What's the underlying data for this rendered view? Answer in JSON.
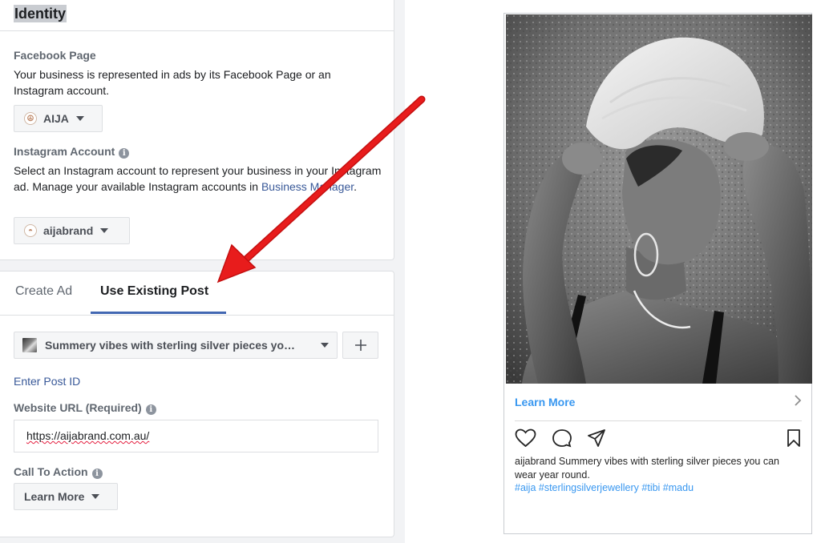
{
  "identity": {
    "title": "Identity",
    "facebook_page": {
      "label": "Facebook Page",
      "description": "Your business is represented in ads by its Facebook Page or an Instagram account.",
      "selected": "AIJA"
    },
    "instagram_account": {
      "label": "Instagram Account",
      "description_prefix": "Select an Instagram account to represent your business in your Instagram ad. Manage your available Instagram accounts in ",
      "link_text": "Business Manager",
      "description_suffix": ".",
      "selected": "aijabrand"
    }
  },
  "tabs": [
    {
      "label": "Create Ad",
      "active": false
    },
    {
      "label": "Use Existing Post",
      "active": true
    }
  ],
  "post": {
    "selected": "Summery vibes with sterling silver pieces yo…",
    "add_icon": "plus-icon"
  },
  "enter_post_id": "Enter Post ID",
  "website_url": {
    "label": "Website URL (Required)",
    "value": "https://aijabrand.com.au/"
  },
  "call_to_action": {
    "label": "Call To Action",
    "selected": "Learn More"
  },
  "preview": {
    "cta": "Learn More",
    "username": "aijabrand",
    "caption": " Summery vibes with sterling silver pieces you can wear year round.",
    "hashtags": "#aija #sterlingsilverjewellery #tibi #madu"
  },
  "colors": {
    "accent": "#4267b2",
    "link": "#385898",
    "instagram_blue": "#3897f0",
    "arrow": "#e81c1c"
  }
}
